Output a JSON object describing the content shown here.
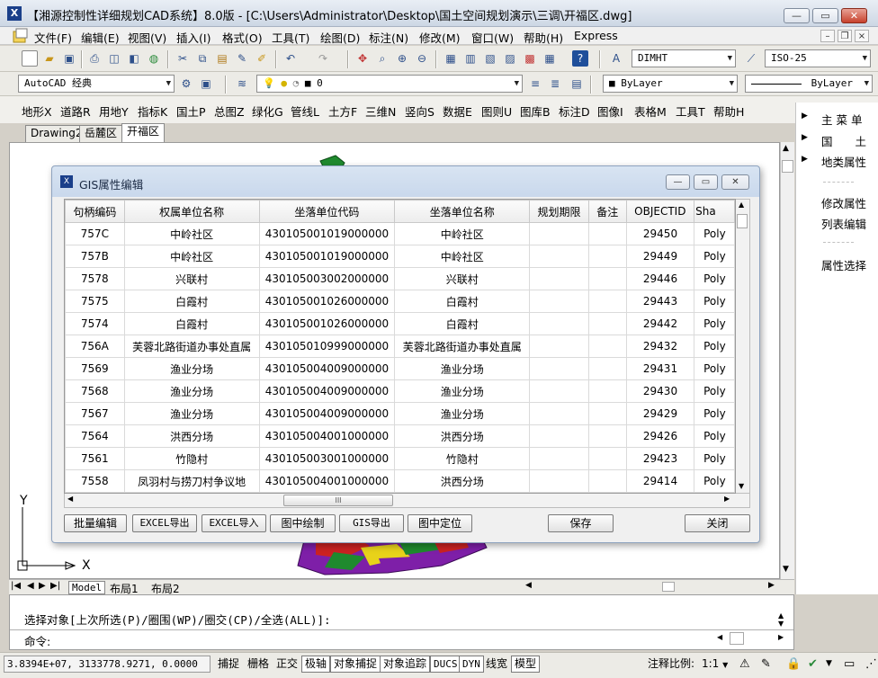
{
  "window": {
    "title": "【湘源控制性详细规划CAD系统】8.0版 - [C:\\Users\\Administrator\\Desktop\\国土空间规划演示\\三调\\开福区.dwg]",
    "min_glyph": "—",
    "max_glyph": "▭",
    "close_glyph": "✕"
  },
  "menu": {
    "items": [
      "文件(F)",
      "编辑(E)",
      "视图(V)",
      "插入(I)",
      "格式(O)",
      "工具(T)",
      "绘图(D)",
      "标注(N)",
      "修改(M)",
      "窗口(W)",
      "帮助(H)",
      "Express"
    ],
    "mdi_min": "–",
    "mdi_restore": "❐",
    "mdi_close": "×"
  },
  "toolbar": {
    "dimstyle": "DIMHT",
    "textstyle": "ISO-25",
    "workspace": "AutoCAD 经典",
    "layer": "0",
    "color": "ByLayer",
    "linetype": "ByLayer"
  },
  "cad_menu": [
    "地形X",
    "道路R",
    "用地Y",
    "指标K",
    "国土P",
    "总图Z",
    "绿化G",
    "管线L",
    "土方F",
    "三维N",
    "竖向S",
    "数据E",
    "图则U",
    "图库B",
    "标注D",
    "图像I",
    "表格M",
    "工具T",
    "帮助H"
  ],
  "drawing_tabs": [
    "Drawing2",
    "岳麓区",
    "开福区"
  ],
  "layout_tabs": [
    "Model",
    "布局1",
    "布局2"
  ],
  "axis": {
    "y": "Y",
    "x": "X"
  },
  "right_panel": {
    "items": [
      "主 菜 单",
      "国　　土",
      "地类属性"
    ],
    "items2": [
      "修改属性",
      "列表编辑"
    ],
    "items3": [
      "属性选择"
    ]
  },
  "dialog": {
    "title": "GIS属性编辑",
    "columns": [
      "句柄编码",
      "权属单位名称",
      "坐落单位代码",
      "坐落单位名称",
      "规划期限",
      "备注",
      "OBJECTID",
      "Sha"
    ],
    "rows": [
      [
        "757C",
        "中岭社区",
        "430105001019000000",
        "中岭社区",
        "",
        "",
        "29450",
        "Poly"
      ],
      [
        "757B",
        "中岭社区",
        "430105001019000000",
        "中岭社区",
        "",
        "",
        "29449",
        "Poly"
      ],
      [
        "7578",
        "兴联村",
        "430105003002000000",
        "兴联村",
        "",
        "",
        "29446",
        "Poly"
      ],
      [
        "7575",
        "白霞村",
        "430105001026000000",
        "白霞村",
        "",
        "",
        "29443",
        "Poly"
      ],
      [
        "7574",
        "白霞村",
        "430105001026000000",
        "白霞村",
        "",
        "",
        "29442",
        "Poly"
      ],
      [
        "756A",
        "芙蓉北路街道办事处直属",
        "430105010999000000",
        "芙蓉北路街道办事处直属",
        "",
        "",
        "29432",
        "Poly"
      ],
      [
        "7569",
        "渔业分场",
        "430105004009000000",
        "渔业分场",
        "",
        "",
        "29431",
        "Poly"
      ],
      [
        "7568",
        "渔业分场",
        "430105004009000000",
        "渔业分场",
        "",
        "",
        "29430",
        "Poly"
      ],
      [
        "7567",
        "渔业分场",
        "430105004009000000",
        "渔业分场",
        "",
        "",
        "29429",
        "Poly"
      ],
      [
        "7564",
        "洪西分场",
        "430105004001000000",
        "洪西分场",
        "",
        "",
        "29426",
        "Poly"
      ],
      [
        "7561",
        "竹隐村",
        "430105003001000000",
        "竹隐村",
        "",
        "",
        "29423",
        "Poly"
      ],
      [
        "7558",
        "凤羽村与捞刀村争议地",
        "430105004001000000",
        "洪西分场",
        "",
        "",
        "29414",
        "Poly"
      ]
    ],
    "buttons": {
      "batch_edit": "批量编辑",
      "excel_export": "EXCEL导出",
      "excel_import": "EXCEL导入",
      "draw_in_map": "图中绘制",
      "gis_export": "GIS导出",
      "locate_in_map": "图中定位",
      "save": "保存",
      "close": "关闭"
    },
    "hscroll_grip": "III"
  },
  "command": {
    "line1": "选择对象[上次所选(P)/圈围(WP)/圈交(CP)/全选(ALL)]:",
    "line2": "命令:"
  },
  "status": {
    "coords": "3.8394E+07, 3133778.9271, 0.0000",
    "toggles": [
      "捕捉",
      "栅格",
      "正交",
      "极轴",
      "对象捕捉",
      "对象追踪",
      "DUCS",
      "DYN",
      "线宽",
      "模型"
    ],
    "toggles_on": [
      false,
      false,
      false,
      true,
      true,
      true,
      true,
      true,
      false,
      true
    ],
    "annotation_scale_label": "注释比例:",
    "annotation_scale_value": "1:1"
  },
  "colors": {
    "accent": "#1a3f8a",
    "map_green": "#1f8a2e",
    "map_purple": "#7e1fa8",
    "map_red": "#cc2222",
    "map_yellow": "#e8d21a"
  }
}
